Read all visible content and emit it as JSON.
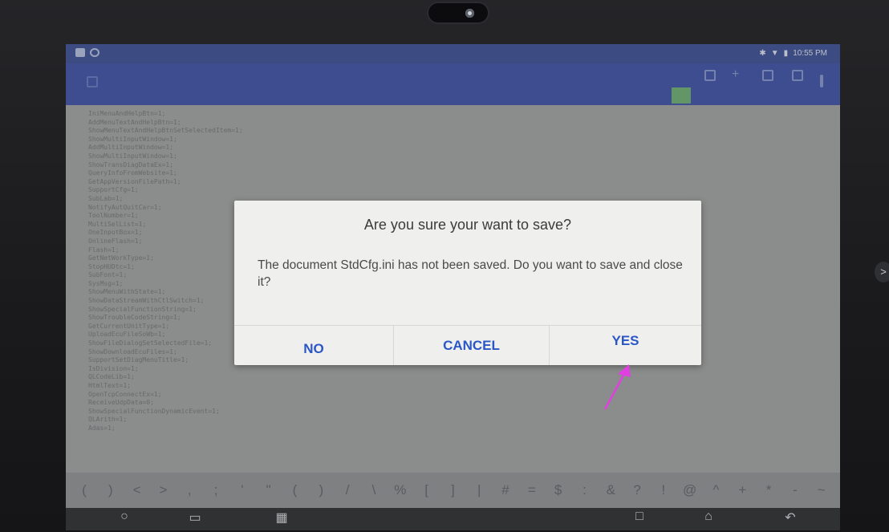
{
  "status_bar": {
    "time": "10:55 PM"
  },
  "editor": {
    "code_lines": [
      "IniMenuAndHelpBtn=1;",
      "AddMenuTextAndHelpBtn=1;",
      "ShowMenuTextAndHelpBtnSetSelectedItem=1;",
      "ShowMultiInputWindow=1;",
      "AddMultiInputWindow=1;",
      "ShowMultiInputWindow=1;",
      "ShowTransDiagDataEx=1;",
      "QueryInfoFromWebsite=1;",
      "GetAppVersionFilePath=1;",
      "SupportCfg=1;",
      "SubLab=1;",
      "NotifyAutQuitCar=1;",
      "ToolNumber=1;",
      "MultiSelList=1;",
      "OneInputBox=1;",
      "OnlineFlash=1;",
      "Flash=1;",
      "GetNetWorkType=1;",
      "StopHUDtc=1;",
      "SubFont=1;",
      "SysMsg=1;",
      "ShowMenuWithState=1;",
      "ShowDataStreamWithCtlSwitch=1;",
      "ShowSpecialFunctionString=1;",
      "ShowTroubleCodeString=1;",
      "GetCurrentUnitType=1;",
      "UploadEcuFileSoWb=1;",
      "ShowFileDialogSetSelectedFile=1;",
      "ShowDownloadEcuFiles=1;",
      "SupportSetDiagMenuTitle=1;",
      "IsDivision=1;",
      "QLCodeLib=1;",
      "HtmlText=1;",
      "OpenTcpConnectEx=1;",
      "ReceiveUdpData=0;",
      "ShowSpecialFunctionDynamicEvent=1;",
      "QLArith=1;",
      "Adas=1;"
    ]
  },
  "symbol_bar": {
    "keys": [
      "(",
      ")",
      "<",
      ">",
      ",",
      ";",
      "'",
      "\"",
      "(",
      ")",
      "/",
      "\\",
      "%",
      "[",
      "]",
      "|",
      "#",
      "=",
      "$",
      ":",
      "&",
      "?",
      "!",
      "@",
      "^",
      "+",
      "*",
      "-",
      "~"
    ]
  },
  "dialog": {
    "title": "Are you sure your want to save?",
    "message": "The document StdCfg.ini has not been saved. Do you want to save and close it?",
    "no_label": "NO",
    "cancel_label": "CANCEL",
    "yes_label": "YES"
  },
  "colors": {
    "toolbar": "#3c4fa0",
    "dialog_button_text": "#2a56c6",
    "annotation_arrow": "#e040e0"
  }
}
